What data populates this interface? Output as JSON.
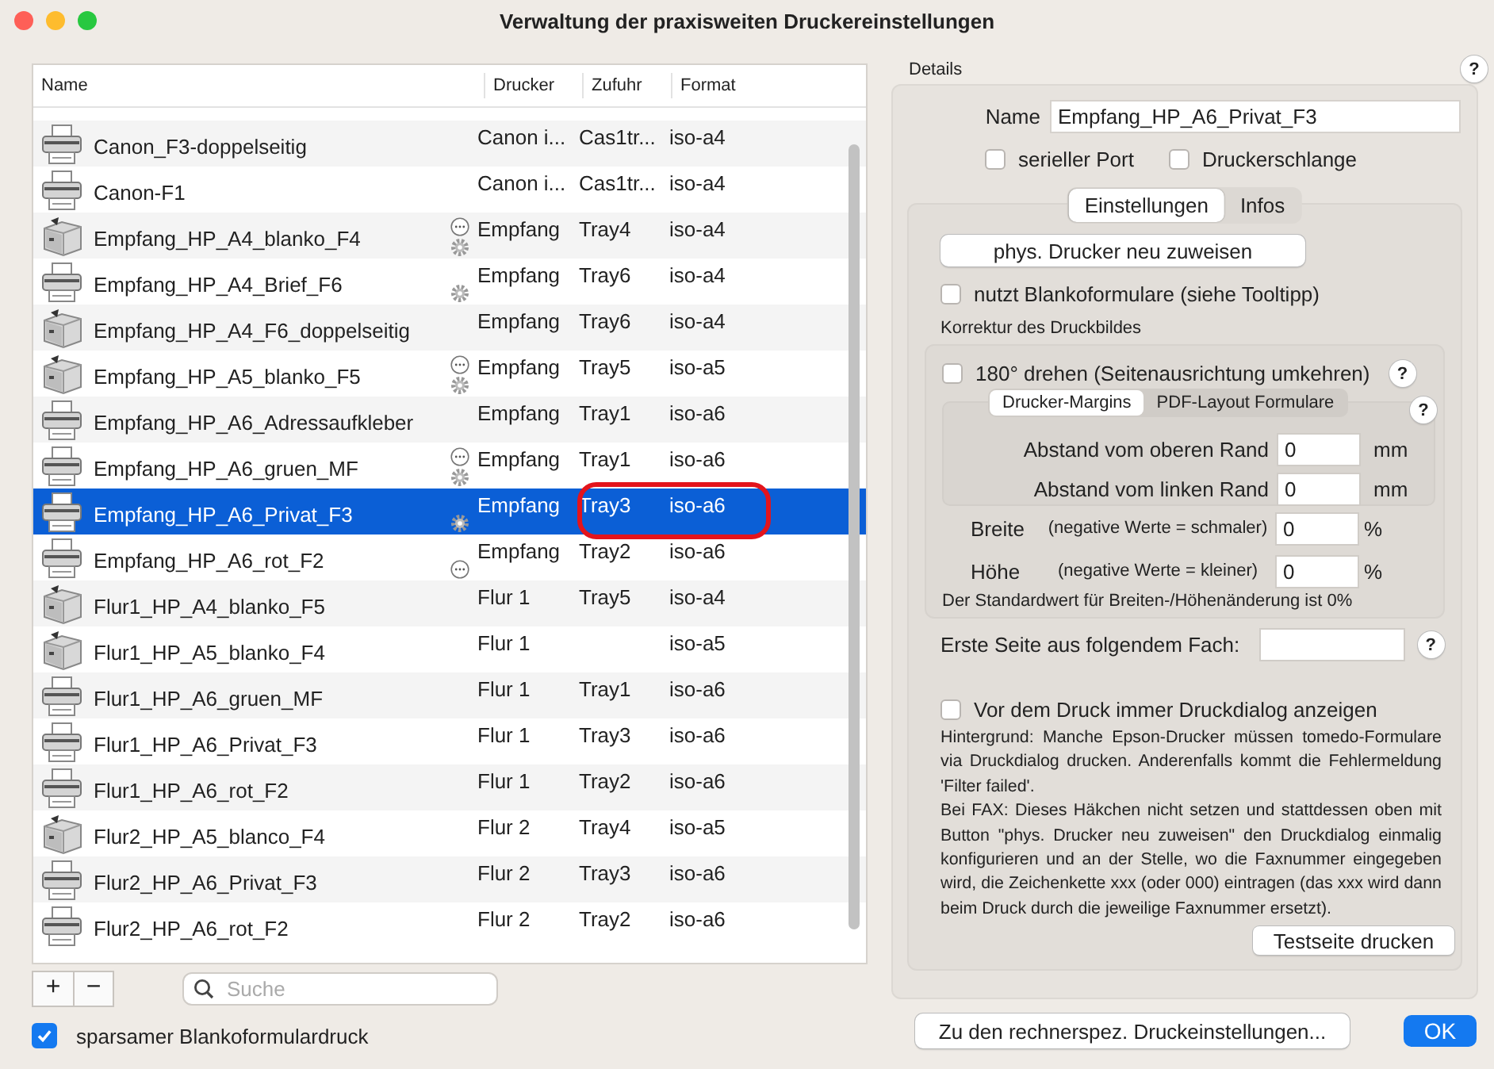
{
  "window": {
    "title": "Verwaltung der praxisweiten Druckereinstellungen"
  },
  "printer_list": {
    "columns": [
      "Name",
      "Drucker",
      "Zufuhr",
      "Format"
    ],
    "rows": [
      {
        "name": "Canon_F3-doppelseitig",
        "kind": "printer",
        "more_badge": false,
        "gear_badge": false,
        "drucker": "Canon i...",
        "zufuhr": "Cas1tr...",
        "format": "iso-a4",
        "selected": false,
        "circled": false
      },
      {
        "name": "Canon-F1",
        "kind": "printer",
        "more_badge": false,
        "gear_badge": false,
        "drucker": "Canon i...",
        "zufuhr": "Cas1tr...",
        "format": "iso-a4",
        "selected": false,
        "circled": false
      },
      {
        "name": "Empfang_HP_A4_blanko_F4",
        "kind": "laser",
        "more_badge": true,
        "gear_badge": true,
        "drucker": "Empfang",
        "zufuhr": "Tray4",
        "format": "iso-a4",
        "selected": false,
        "circled": false
      },
      {
        "name": "Empfang_HP_A4_Brief_F6",
        "kind": "printer",
        "more_badge": false,
        "gear_badge": true,
        "drucker": "Empfang",
        "zufuhr": "Tray6",
        "format": "iso-a4",
        "selected": false,
        "circled": false
      },
      {
        "name": "Empfang_HP_A4_F6_doppelseitig",
        "kind": "laser",
        "more_badge": false,
        "gear_badge": false,
        "drucker": "Empfang",
        "zufuhr": "Tray6",
        "format": "iso-a4",
        "selected": false,
        "circled": false
      },
      {
        "name": "Empfang_HP_A5_blanko_F5",
        "kind": "laser",
        "more_badge": true,
        "gear_badge": true,
        "drucker": "Empfang",
        "zufuhr": "Tray5",
        "format": "iso-a5",
        "selected": false,
        "circled": false
      },
      {
        "name": "Empfang_HP_A6_Adressaufkleber",
        "kind": "printer",
        "more_badge": false,
        "gear_badge": false,
        "drucker": "Empfang",
        "zufuhr": "Tray1",
        "format": "iso-a6",
        "selected": false,
        "circled": false
      },
      {
        "name": "Empfang_HP_A6_gruen_MF",
        "kind": "printer",
        "more_badge": true,
        "gear_badge": true,
        "drucker": "Empfang",
        "zufuhr": "Tray1",
        "format": "iso-a6",
        "selected": false,
        "circled": false
      },
      {
        "name": "Empfang_HP_A6_Privat_F3",
        "kind": "printer",
        "more_badge": false,
        "gear_badge": true,
        "drucker": "Empfang",
        "zufuhr": "Tray3",
        "format": "iso-a6",
        "selected": true,
        "circled": true
      },
      {
        "name": "Empfang_HP_A6_rot_F2",
        "kind": "printer",
        "more_badge": true,
        "gear_badge": false,
        "drucker": "Empfang",
        "zufuhr": "Tray2",
        "format": "iso-a6",
        "selected": false,
        "circled": false
      },
      {
        "name": "Flur1_HP_A4_blanko_F5",
        "kind": "laser",
        "more_badge": false,
        "gear_badge": false,
        "drucker": "Flur 1",
        "zufuhr": "Tray5",
        "format": "iso-a4",
        "selected": false,
        "circled": false
      },
      {
        "name": "Flur1_HP_A5_blanko_F4",
        "kind": "laser",
        "more_badge": false,
        "gear_badge": false,
        "drucker": "Flur 1",
        "format": "iso-a5",
        "selected": false,
        "circled": false
      },
      {
        "name": "Flur1_HP_A6_gruen_MF",
        "kind": "printer",
        "more_badge": false,
        "gear_badge": false,
        "drucker": "Flur 1",
        "zufuhr": "Tray1",
        "format": "iso-a6",
        "selected": false,
        "circled": false
      },
      {
        "name": "Flur1_HP_A6_Privat_F3",
        "kind": "printer",
        "more_badge": false,
        "gear_badge": false,
        "drucker": "Flur 1",
        "zufuhr": "Tray3",
        "format": "iso-a6",
        "selected": false,
        "circled": false
      },
      {
        "name": "Flur1_HP_A6_rot_F2",
        "kind": "printer",
        "more_badge": false,
        "gear_badge": false,
        "drucker": "Flur 1",
        "zufuhr": "Tray2",
        "format": "iso-a6",
        "selected": false,
        "circled": false
      },
      {
        "name": "Flur2_HP_A5_blanco_F4",
        "kind": "laser",
        "more_badge": false,
        "gear_badge": false,
        "drucker": "Flur 2",
        "zufuhr": "Tray4",
        "format": "iso-a5",
        "selected": false,
        "circled": false
      },
      {
        "name": "Flur2_HP_A6_Privat_F3",
        "kind": "printer",
        "more_badge": false,
        "gear_badge": false,
        "drucker": "Flur 2",
        "zufuhr": "Tray3",
        "format": "iso-a6",
        "selected": false,
        "circled": false
      },
      {
        "name": "Flur2_HP_A6_rot_F2",
        "kind": "printer",
        "more_badge": false,
        "gear_badge": false,
        "drucker": "Flur 2",
        "zufuhr": "Tray2",
        "format": "iso-a6",
        "selected": false,
        "circled": false
      }
    ],
    "add_button": "+",
    "remove_button": "−",
    "search": {
      "placeholder": "Suche"
    },
    "sparse_print": {
      "label": "sparsamer Blankoformulardruck",
      "checked": true
    }
  },
  "details": {
    "title": "Details",
    "help": "?",
    "name_label": "Name",
    "name_value": "Empfang_HP_A6_Privat_F3",
    "options": [
      {
        "label": "serieller Port",
        "checked": false
      },
      {
        "label": "Druckerschlange",
        "checked": false
      }
    ],
    "tabs": [
      {
        "label": "Einstellungen",
        "selected": true
      },
      {
        "label": "Infos",
        "selected": false
      }
    ],
    "assign_button": "phys. Drucker neu zuweisen",
    "blank_forms": {
      "label": "nutzt Blankoformulare (siehe Tooltipp)",
      "checked": false
    },
    "correction_title": "Korrektur des Druckbildes",
    "rotate": {
      "label": "180° drehen (Seitenausrichtung umkehren)",
      "checked": false,
      "help": "?"
    },
    "margin_tabs": [
      {
        "label": "Drucker-Margins",
        "selected": true
      },
      {
        "label": "PDF-Layout Formulare",
        "selected": false
      }
    ],
    "margin_help": "?",
    "margins": [
      {
        "label": "Abstand vom oberen Rand",
        "value": "0",
        "unit": "mm"
      },
      {
        "label": "Abstand vom linken Rand",
        "value": "0",
        "unit": "mm"
      }
    ],
    "scale": [
      {
        "label": "Breite",
        "hint": "(negative Werte = schmaler)",
        "value": "0",
        "unit": "%"
      },
      {
        "label": "Höhe",
        "hint": "(negative Werte = kleiner)",
        "value": "0",
        "unit": "%"
      }
    ],
    "scale_note": "Der Standardwert für Breiten-/Höhenänderung ist 0%",
    "first_page": {
      "label": "Erste Seite aus folgendem Fach:",
      "help": "?"
    },
    "print_dialog": {
      "label": "Vor dem Druck immer Druckdialog anzeigen",
      "checked": false
    },
    "info_text": [
      "Hintergrund: Manche Epson-Drucker müssen tomedo-Formulare via Druckdialog drucken. Anderenfalls kommt die Fehlermeldung 'Filter failed'.",
      "Bei FAX: Dieses Häkchen nicht setzen und stattdessen oben mit Button \"phys. Drucker neu zuweisen\" den Druckdialog einmalig konfigurieren und an der Stelle, wo die Faxnummer eingegeben wird, die Zeichenkette xxx (oder 000) eintragen (das xxx wird dann beim Druck durch die jeweilige Faxnummer ersetzt)."
    ],
    "test_button": "Testseite drucken"
  },
  "footer": {
    "settings_button": "Zu den rechnerspez. Druckeinstellungen...",
    "ok_button": "OK"
  }
}
